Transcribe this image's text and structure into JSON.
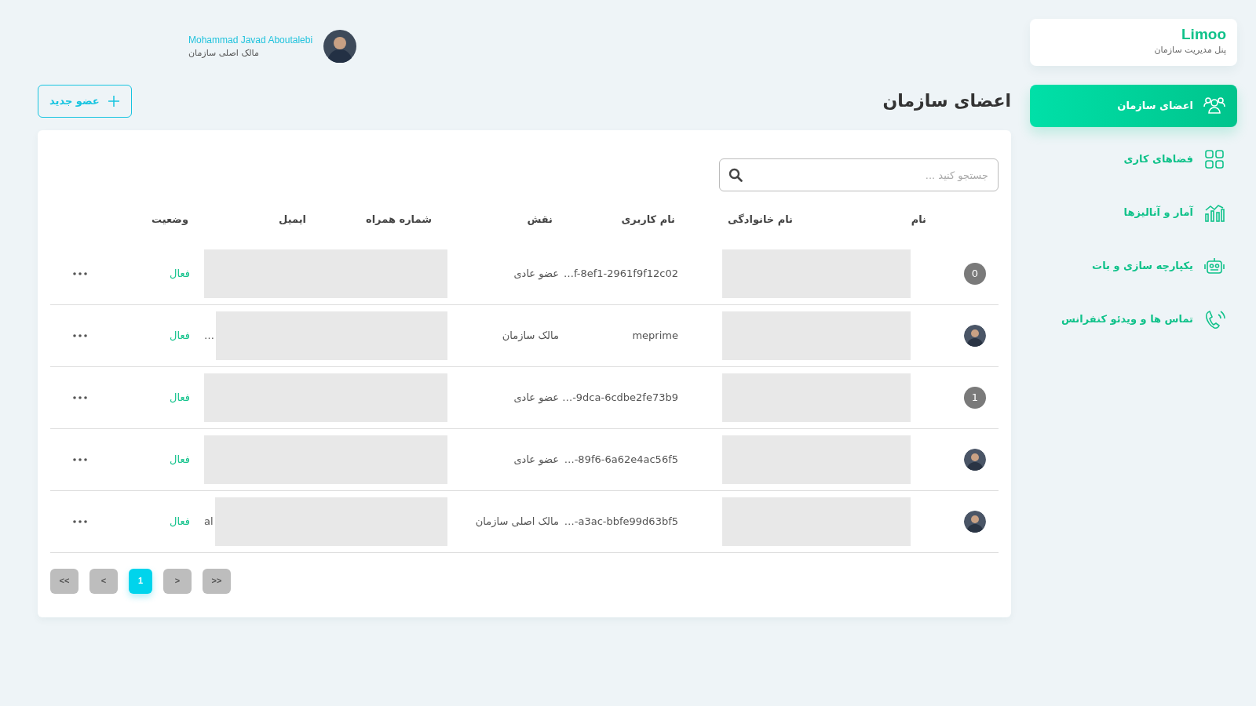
{
  "user": {
    "name": "Mohammad Javad Aboutalebi",
    "role": "مالک اصلی سازمان"
  },
  "brand": {
    "title": "Limoo",
    "subtitle": "پنل مدیریت سازمان"
  },
  "sidebar": {
    "items": [
      {
        "label": "اعضای سازمان",
        "kind": "people",
        "selected": true
      },
      {
        "label": "فضاهای کاری",
        "kind": "grid",
        "selected": false
      },
      {
        "label": "آمار و آنالیزها",
        "kind": "chart",
        "selected": false
      },
      {
        "label": "یکپارچه سازی و بات",
        "kind": "robot",
        "selected": false
      },
      {
        "label": "تماس ها و ویدئو کنفرانس",
        "kind": "call",
        "selected": false
      }
    ]
  },
  "page": {
    "title": "اعضای سازمان",
    "add_button": "عضو جدید"
  },
  "search": {
    "placeholder": "جستجو کنید ..."
  },
  "table": {
    "columns": [
      "نام",
      "نام خانوادگی",
      "نام کاربری",
      "نقش",
      "شماره همراه",
      "ایمیل",
      "وضعیت"
    ],
    "rows": [
      {
        "avatar": {
          "kind": "initial",
          "text": "0"
        },
        "username": "…f-8ef1-2961f9f12c02",
        "role": "عضو عادی",
        "status": "فعال"
      },
      {
        "avatar": {
          "kind": "photo"
        },
        "username": "meprime",
        "role": "مالک سازمان",
        "email_fragment": "…",
        "status": "فعال"
      },
      {
        "avatar": {
          "kind": "initial",
          "text": "1"
        },
        "username": "…-9dca-6cdbe2fe73b9",
        "role": "عضو عادی",
        "status": "فعال"
      },
      {
        "avatar": {
          "kind": "photo"
        },
        "username": "…-89f6-6a62e4ac56f5",
        "role": "عضو عادی",
        "status": "فعال"
      },
      {
        "avatar": {
          "kind": "photo"
        },
        "username": "…-a3ac-bbfe99d63bf5",
        "role": "مالک اصلی سازمان",
        "email_fragment": "al",
        "status": "فعال"
      }
    ]
  },
  "pagination": [
    {
      "label": ">>",
      "selected": false
    },
    {
      "label": ">",
      "selected": false
    },
    {
      "label": "1",
      "selected": true
    },
    {
      "label": "<",
      "selected": false
    },
    {
      "label": "<<",
      "selected": false
    }
  ]
}
